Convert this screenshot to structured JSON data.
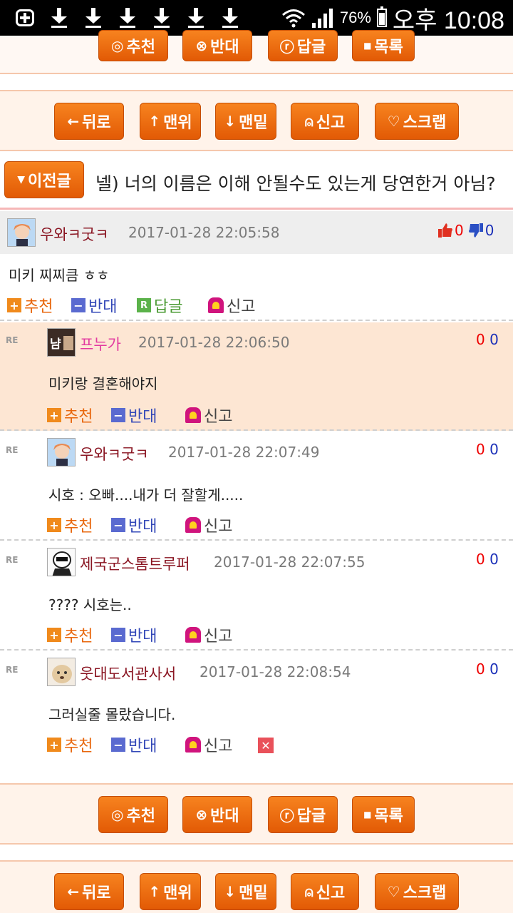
{
  "status": {
    "battery": "76%",
    "time": "오후 10:08"
  },
  "buttons_a": {
    "recommend": "추천",
    "oppose": "반대",
    "reply": "답글",
    "list": "목록"
  },
  "buttons_b": {
    "back": "뒤로",
    "top": "맨위",
    "bottom": "맨밑",
    "report": "신고",
    "scrap": "스크랩"
  },
  "prev": {
    "label": "이전글",
    "title": "넬) 너의 이름은 이해 안될수도 있는게 당연한거 아님?"
  },
  "main_comment": {
    "nick": "우와ㅋ굿ㅋ",
    "date": "2017-01-28 22:05:58",
    "up": "0",
    "down": "0",
    "body": "미키 찌찌큼 ㅎㅎ",
    "recommend": "추천",
    "oppose": "반대",
    "reply": "답글",
    "report": "신고"
  },
  "replies": [
    {
      "re": "RE",
      "nick": "프누가",
      "date": "2017-01-28 22:06:50",
      "up": "0",
      "down": "0",
      "body": "미키랑 결혼해야지",
      "recommend": "추천",
      "oppose": "반대",
      "report": "신고"
    },
    {
      "re": "RE",
      "nick": "우와ㅋ굿ㅋ",
      "date": "2017-01-28 22:07:49",
      "up": "0",
      "down": "0",
      "body": "시호 : 오빠....내가 더 잘할게.....",
      "recommend": "추천",
      "oppose": "반대",
      "report": "신고"
    },
    {
      "re": "RE",
      "nick": "제국군스톰트루퍼",
      "date": "2017-01-28 22:07:55",
      "up": "0",
      "down": "0",
      "body": "???? 시호는..",
      "recommend": "추천",
      "oppose": "반대",
      "report": "신고"
    },
    {
      "re": "RE",
      "nick": "웃대도서관사서",
      "date": "2017-01-28 22:08:54",
      "up": "0",
      "down": "0",
      "body": "그러실줄 몰랐습니다.",
      "recommend": "추천",
      "oppose": "반대",
      "report": "신고"
    }
  ],
  "colors": {
    "accent": "#e8670d",
    "highlight": "#fde6d3",
    "nick": "#8a1522"
  }
}
